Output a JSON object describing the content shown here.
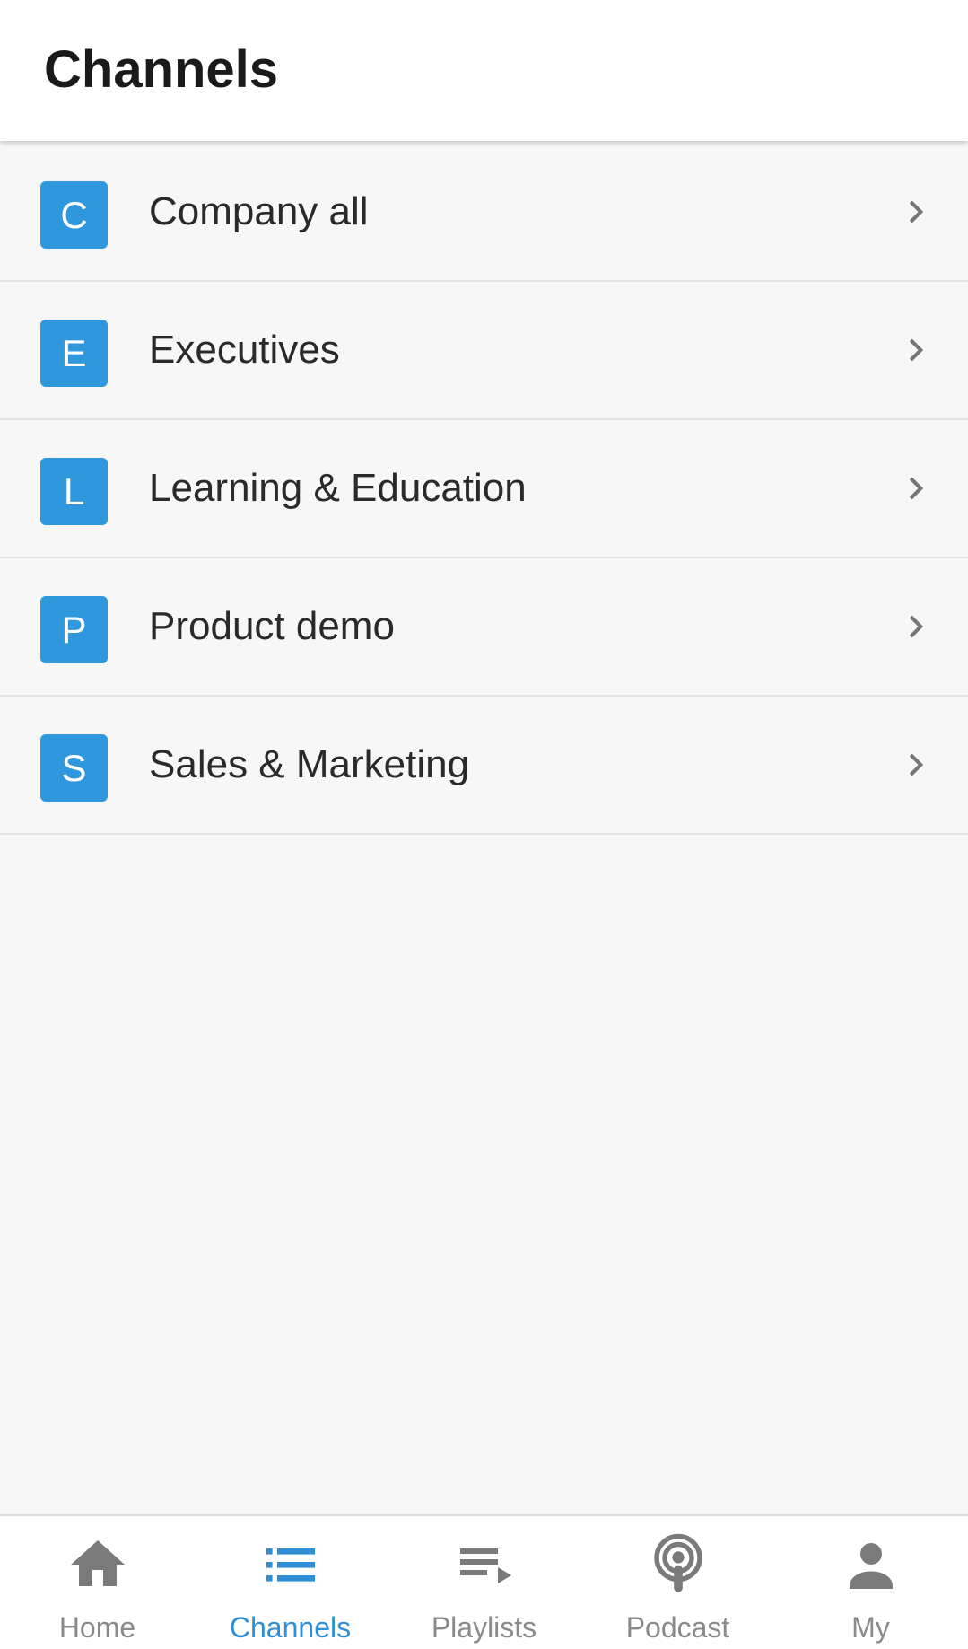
{
  "header": {
    "title": "Channels"
  },
  "channels": [
    {
      "initial": "C",
      "name": "Company all"
    },
    {
      "initial": "E",
      "name": "Executives"
    },
    {
      "initial": "L",
      "name": "Learning & Education"
    },
    {
      "initial": "P",
      "name": "Product demo"
    },
    {
      "initial": "S",
      "name": "Sales & Marketing"
    }
  ],
  "bottom_nav": {
    "items": [
      {
        "label": "Home",
        "icon": "home-icon"
      },
      {
        "label": "Channels",
        "icon": "list-icon",
        "active": true
      },
      {
        "label": "Playlists",
        "icon": "playlist-play-icon"
      },
      {
        "label": "Podcast",
        "icon": "podcast-icon"
      },
      {
        "label": "My",
        "icon": "person-icon"
      }
    ]
  },
  "colors": {
    "accent": "#2f97dc",
    "active_nav": "#2f8fd6",
    "inactive_nav": "#8a8a8a",
    "background": "#f7f7f7"
  }
}
